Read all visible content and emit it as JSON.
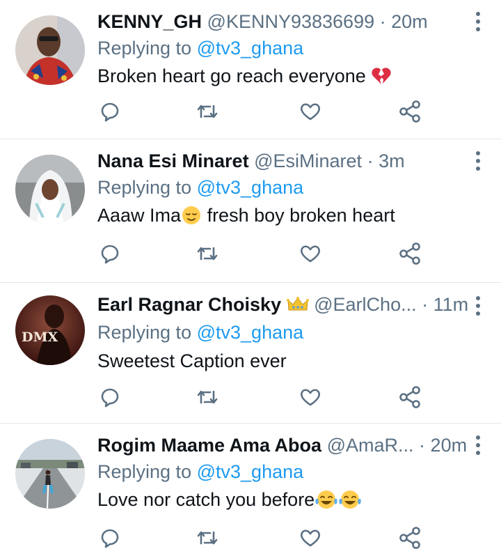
{
  "tweets": [
    {
      "name": "KENNY_GH",
      "handle": "@KENNY93836699",
      "dot": "·",
      "time": "20m",
      "replying_label": "Replying to",
      "replying_to": "@tv3_ghana",
      "text": "Broken heart go reach everyone",
      "emoji": "broken-heart",
      "avatar": "person-in-red-shirt-sunglasses"
    },
    {
      "name": "Nana Esi Minaret",
      "handle": "@EsiMinaret",
      "dot": "·",
      "time": "3m",
      "replying_label": "Replying to",
      "replying_to": "@tv3_ghana",
      "text_before": "Aaaw Ima",
      "text_after": " fresh boy broken heart",
      "emoji": "relieved-face",
      "avatar": "woman-in-white-headscarf"
    },
    {
      "name": "Earl Ragnar Choisky",
      "handle": "@EarlCho...",
      "dot": "·",
      "time": "11m",
      "replying_label": "Replying to",
      "replying_to": "@tv3_ghana",
      "text": "Sweetest Caption ever",
      "badge": "crown",
      "avatar": "DMX",
      "avatar_text": "DMX"
    },
    {
      "name": "Rogim Maame Ama Aboa",
      "handle": "@AmaR...",
      "dot": "·",
      "time": "20m",
      "replying_label": "Replying to",
      "replying_to": "@tv3_ghana",
      "text": "Love nor catch you before",
      "emoji": "tears-of-joy",
      "avatar": "person-standing-on-road"
    }
  ],
  "colors": {
    "link": "#1d9bf0",
    "muted": "#5b7083",
    "text": "#0f1419",
    "divider": "#e3e6e8"
  },
  "icons": [
    "reply-icon",
    "retweet-icon",
    "like-icon",
    "share-icon",
    "more-icon"
  ]
}
